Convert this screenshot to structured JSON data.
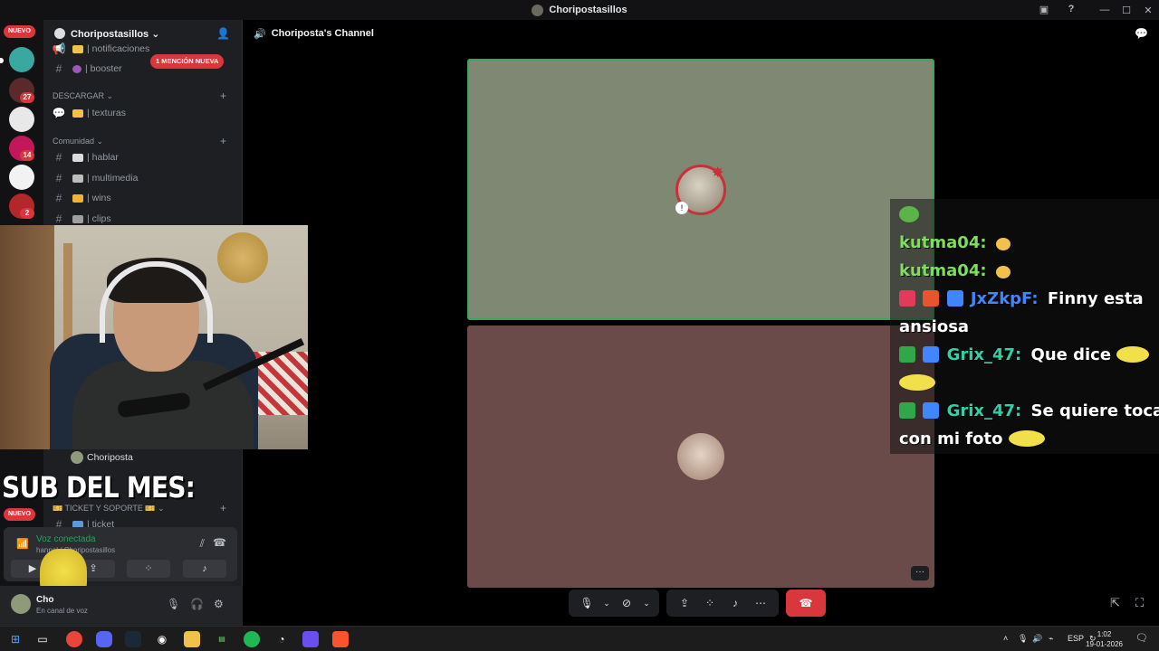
{
  "window": {
    "title": "Choripostasillos",
    "controls": [
      "—",
      "☐",
      "✕"
    ]
  },
  "rail": {
    "new_label": "NUEVO",
    "badges": [
      "14",
      "27",
      "14",
      "2"
    ]
  },
  "sidebar": {
    "guild_name": "Choripostasillos ⌄",
    "mention_pill": "1 MENCIÓN NUEVA",
    "channels_top": [
      {
        "label": "| notificaciones"
      },
      {
        "label": "| booster"
      }
    ],
    "categories": {
      "descargar": "DESCARGAR ⌄",
      "comunidad": "Comunidad ⌄",
      "ticket": "🎫 TICKET Y SOPORTE 🎫 ⌄"
    },
    "descargar_channels": [
      {
        "label": "| texturas"
      }
    ],
    "comunidad_channels": [
      {
        "label": "| hablar"
      },
      {
        "label": "| multimedia"
      },
      {
        "label": "| wins"
      },
      {
        "label": "| clips"
      }
    ],
    "voice_user": "Choriposta",
    "ticket_channel": "| ticket"
  },
  "overlay": {
    "sub_title": "SUB DEL MES:"
  },
  "voice_panel": {
    "status": "Voz conectada",
    "subtitle": "hannel / Choripostasillos"
  },
  "userbar": {
    "name": "Cho",
    "status": "En canal de voz"
  },
  "stage": {
    "channel_title": "Choriposta's Channel",
    "more_label": "···"
  },
  "chat": {
    "messages": [
      {
        "user": "kutma04:",
        "text": "",
        "user_color": "#7ee05a"
      },
      {
        "user": "kutma04:",
        "text": "",
        "user_color": "#7ee05a"
      },
      {
        "user": "JxZkpF:",
        "text": "Finny esta",
        "user_color": "#3f86ff"
      },
      {
        "user": "",
        "text": "ansiosa",
        "user_color": "#ffffff"
      },
      {
        "user": "Grix_47:",
        "text": "Que dice",
        "user_color": "#2fd0a8"
      },
      {
        "user": "Grix_47:",
        "text": "Se quiere tocar",
        "user_color": "#2fd0a8"
      },
      {
        "user": "",
        "text": "con mi foto",
        "user_color": "#ffffff"
      }
    ]
  },
  "taskbar": {
    "lang": "ESP",
    "time": "1:02",
    "date": "19-01-2026"
  },
  "colors": {
    "accent_red": "#da373c",
    "online_green": "#23a55a",
    "speaking_border": "#3ba55c"
  }
}
